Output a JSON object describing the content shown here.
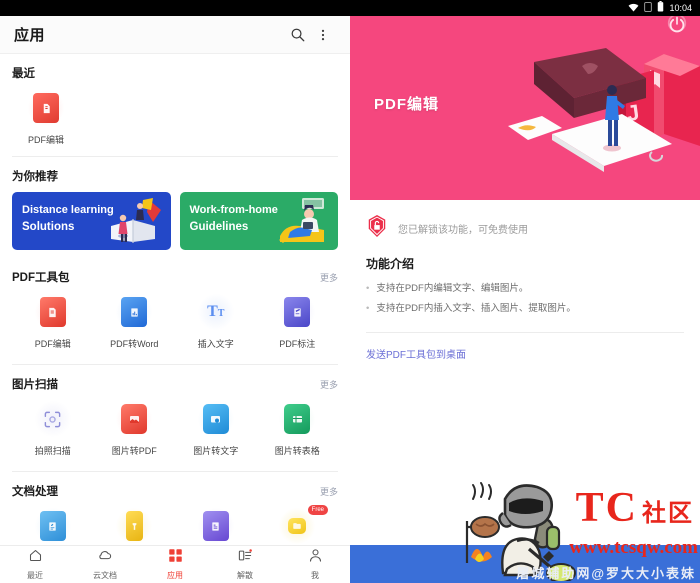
{
  "statusbar": {
    "time": "10:04",
    "icons": [
      "wifi-icon",
      "sim-icon",
      "battery-icon"
    ]
  },
  "left": {
    "appbar": {
      "title": "应用",
      "search_icon": "search-icon",
      "overflow_icon": "more-vertical-icon"
    },
    "recent": {
      "title": "最近",
      "items": [
        {
          "label": "PDF编辑",
          "icon": "pdf-edit-icon",
          "color": "#ef4444"
        }
      ]
    },
    "recommend": {
      "title": "为你推荐",
      "banners": [
        {
          "line1": "Distance learning",
          "line2": "Solutions",
          "color": "#2348c8",
          "art": "distance-learning-illustration"
        },
        {
          "line1": "Work-from-home",
          "line2": "Guidelines",
          "color": "#2bab67",
          "art": "work-from-home-illustration"
        }
      ]
    },
    "pdf_toolkit": {
      "title": "PDF工具包",
      "more": "更多",
      "items": [
        {
          "label": "PDF编辑",
          "icon": "pdf-edit-icon",
          "color": "#ef4444"
        },
        {
          "label": "PDF转Word",
          "icon": "pdf-to-word-icon",
          "color": "#2f7ae5"
        },
        {
          "label": "插入文字",
          "icon": "insert-text-icon",
          "color": "#5b8ef0"
        },
        {
          "label": "PDF标注",
          "icon": "pdf-annotate-icon",
          "color": "#5a56d6"
        }
      ]
    },
    "image_scan": {
      "title": "图片扫描",
      "more": "更多",
      "items": [
        {
          "label": "拍照扫描",
          "icon": "camera-scan-icon",
          "color": "#8e8ed8"
        },
        {
          "label": "图片转PDF",
          "icon": "image-to-pdf-icon",
          "color": "#ef4444"
        },
        {
          "label": "图片转文字",
          "icon": "image-to-text-icon",
          "color": "#2f9fe5"
        },
        {
          "label": "图片转表格",
          "icon": "image-to-table-icon",
          "color": "#1eac6a"
        }
      ]
    },
    "doc_process": {
      "title": "文档处理",
      "more": "更多",
      "items": [
        {
          "label": "",
          "icon": "doc-edit-icon",
          "color": "#4ba3e8",
          "badge": ""
        },
        {
          "label": "",
          "icon": "doc-compress-icon",
          "color": "#f0c419",
          "badge": ""
        },
        {
          "label": "",
          "icon": "doc-convert-icon",
          "color": "#7b5ce0",
          "badge": ""
        },
        {
          "label": "",
          "icon": "doc-merge-icon",
          "color": "#f0c419",
          "badge": "Free"
        }
      ]
    },
    "bottomnav": [
      {
        "label": "最近",
        "icon": "home-icon",
        "active": false
      },
      {
        "label": "云文档",
        "icon": "cloud-icon",
        "active": false
      },
      {
        "label": "应用",
        "icon": "apps-grid-icon",
        "active": true
      },
      {
        "label": "解散",
        "icon": "list-icon",
        "active": false
      },
      {
        "label": "我",
        "icon": "profile-icon",
        "active": false
      }
    ]
  },
  "right": {
    "hero": {
      "title": "PDF编辑",
      "bg_color": "#f5477e",
      "power_icon": "power-icon",
      "art": "pdf-editing-isometric-illustration"
    },
    "unlock": {
      "icon": "unlock-badge-icon",
      "text": "您已解锁该功能，可免费使用"
    },
    "intro": {
      "title": "功能介绍",
      "bullets": [
        "支持在PDF内编辑文字、编辑图片。",
        "支持在PDF内插入文字、插入图片、提取图片。"
      ]
    },
    "send_link": "发送PDF工具包到桌面",
    "blue_bar_color": "#3a6fd8"
  },
  "watermark": {
    "brand": "TC",
    "brand_cn": "社区",
    "url": "www.tcsqw.com",
    "subtitle": "屠城辅助网@罗大大小表妹",
    "mascot": "soldier-cooking-icon",
    "color": "#e8261c"
  }
}
